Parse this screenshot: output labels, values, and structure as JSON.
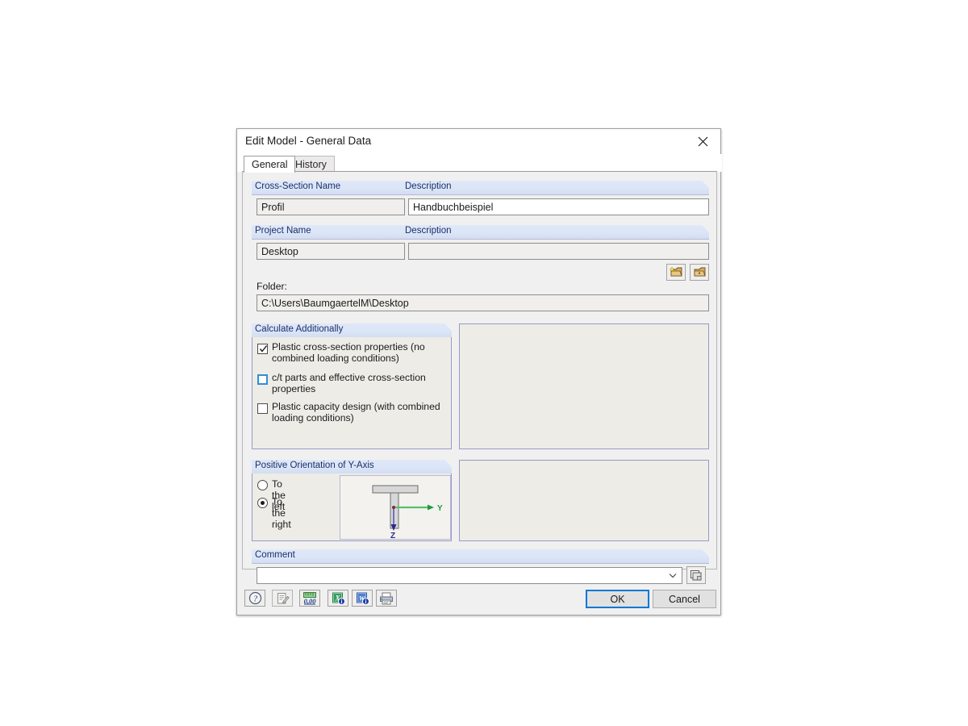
{
  "window": {
    "title": "Edit Model - General Data",
    "close_icon": "close-icon"
  },
  "tabs": [
    {
      "label": "General",
      "active": true
    },
    {
      "label": "History",
      "active": false
    }
  ],
  "sections": {
    "cross_section": {
      "name_label": "Cross-Section Name",
      "name_value": "Profil",
      "description_label": "Description",
      "description_value": "Handbuchbeispiel"
    },
    "project": {
      "name_label": "Project Name",
      "name_value": "Desktop",
      "description_label": "Description",
      "description_value": "",
      "folder_label": "Folder:",
      "folder_value": "C:\\Users\\BaumgaertelM\\Desktop",
      "new_folder_icon": "new-folder-icon",
      "browse_folder_icon": "browse-folder-icon"
    },
    "calculate": {
      "title": "Calculate Additionally",
      "options": [
        {
          "label": "Plastic cross-section properties (no combined loading conditions)",
          "checked": true,
          "hover": false
        },
        {
          "label": "c/t parts and effective cross-section properties",
          "checked": false,
          "hover": true
        },
        {
          "label": "Plastic capacity design (with combined loading conditions)",
          "checked": false,
          "hover": false
        }
      ]
    },
    "orientation": {
      "title": "Positive Orientation of Y-Axis",
      "options": [
        {
          "label": "To the left",
          "selected": false
        },
        {
          "label": "To the right",
          "selected": true
        }
      ],
      "preview": {
        "name": "t-section-preview",
        "y_axis_label": "Y",
        "z_axis_label": "Z",
        "y_axis_color": "#1f9a3c",
        "z_axis_color": "#2a2a8c"
      }
    },
    "comment": {
      "title": "Comment",
      "value": "",
      "dropdown_icon": "chevron-down-icon",
      "pick_comment_icon": "comment-library-icon"
    }
  },
  "toolbar": {
    "buttons": [
      {
        "name": "help-button",
        "icon": "question-mark-icon",
        "enabled": true
      },
      {
        "name": "edit-note-button",
        "icon": "notepad-pencil-icon",
        "enabled": false
      },
      {
        "name": "units-button",
        "icon": "units-decimal-icon",
        "enabled": true
      },
      {
        "name": "excel-export-button",
        "icon": "excel-export-icon",
        "enabled": true
      },
      {
        "name": "word-export-button",
        "icon": "word-export-icon",
        "enabled": true
      },
      {
        "name": "printout-report-button",
        "icon": "printout-report-icon",
        "enabled": true
      }
    ]
  },
  "footer": {
    "ok_label": "OK",
    "cancel_label": "Cancel"
  },
  "colors": {
    "accent": "#0078d7",
    "band": "#dbe5f7",
    "band_text": "#1b2f6b",
    "dialog_bg": "#f0f0f0",
    "groupbox_bg": "#edece7"
  }
}
